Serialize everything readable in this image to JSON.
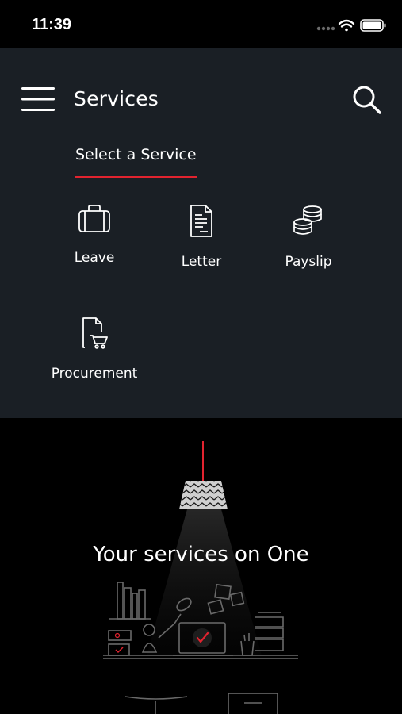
{
  "status_bar": {
    "time": "11:39",
    "icons": [
      "signal-dots-icon",
      "wifi-icon",
      "battery-icon"
    ]
  },
  "header": {
    "menu_icon": "hamburger-menu-icon",
    "title": "Services",
    "search_icon": "search-icon"
  },
  "tabs": [
    {
      "label": "Select a Service",
      "active": true
    }
  ],
  "services": [
    {
      "label": "Leave",
      "icon": "briefcase-icon"
    },
    {
      "label": "Letter",
      "icon": "document-icon"
    },
    {
      "label": "Payslip",
      "icon": "coins-icon"
    },
    {
      "label": "Procurement",
      "icon": "document-cart-icon"
    }
  ],
  "hero": {
    "title": "Your services on One"
  },
  "colors": {
    "panel_background": "#1a1f25",
    "page_background": "#000000",
    "accent": "#e2232f",
    "text": "#ffffff"
  }
}
